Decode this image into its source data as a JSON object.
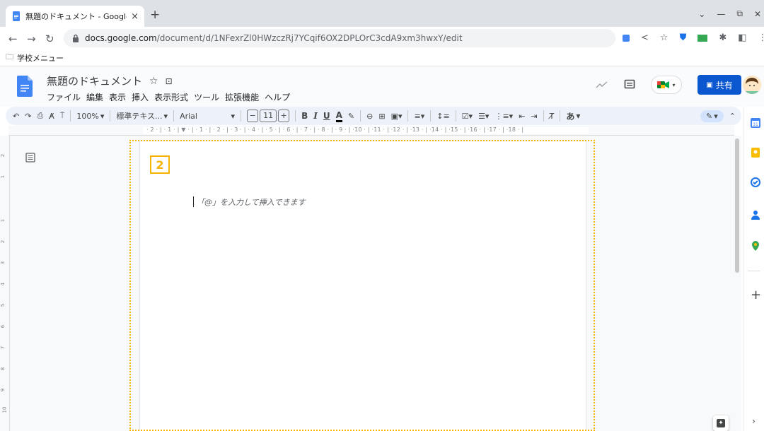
{
  "browser": {
    "tab_title": "無題のドキュメント - Google",
    "tab_close": "×",
    "new_tab": "+",
    "window_controls": [
      "⌄",
      "—",
      "⧉",
      "✕"
    ],
    "url_host": "docs.google.com",
    "url_path": "/document/d/1NFexrZl0HWzczRj7YCqif6OX2DPLOrC3cdA9xm3hwxY/edit",
    "bookmark_folder": "学校メニュー"
  },
  "docs": {
    "title": "無題のドキュメント",
    "menu": [
      "ファイル",
      "編集",
      "表示",
      "挿入",
      "表示形式",
      "ツール",
      "拡張機能",
      "ヘルプ"
    ],
    "share_label": "共有",
    "toolbar": {
      "zoom": "100%",
      "style": "標準テキス...",
      "font": "Arial",
      "font_size": "11",
      "bold": "B",
      "italic": "I",
      "underline": "U",
      "text_color": "A",
      "ime": "あ"
    },
    "ruler_ticks": "· 2 · | · 1 · | ▼ · | · 1 · | · 2 · | · 3 · | · 4 · | · 5 · | · 6 · | · 7 · | · 8 · | · 9 · | ·10 · | ·11 · | ·12 · | ·13 · | ·14 · | ·15 · | ·16 · | ·17 · | ·18 · |",
    "placeholder": "「@」を入力して挿入できます"
  },
  "annotation": {
    "step_number": "2",
    "color": "#f4b400"
  },
  "colors": {
    "docs_blue": "#4285f4",
    "share_button": "#0b57d0",
    "toolbar_bg": "#edf2fa"
  },
  "icons": {
    "docs": "docs-icon",
    "star": "star-icon",
    "folder": "move-folder-icon",
    "comment": "comment-icon",
    "meet": "meet-icon",
    "lock": "lock-icon",
    "side_calendar": "calendar-icon",
    "side_keep": "keep-icon",
    "side_tasks": "tasks-icon",
    "side_contacts": "contacts-icon",
    "side_maps": "maps-icon"
  }
}
